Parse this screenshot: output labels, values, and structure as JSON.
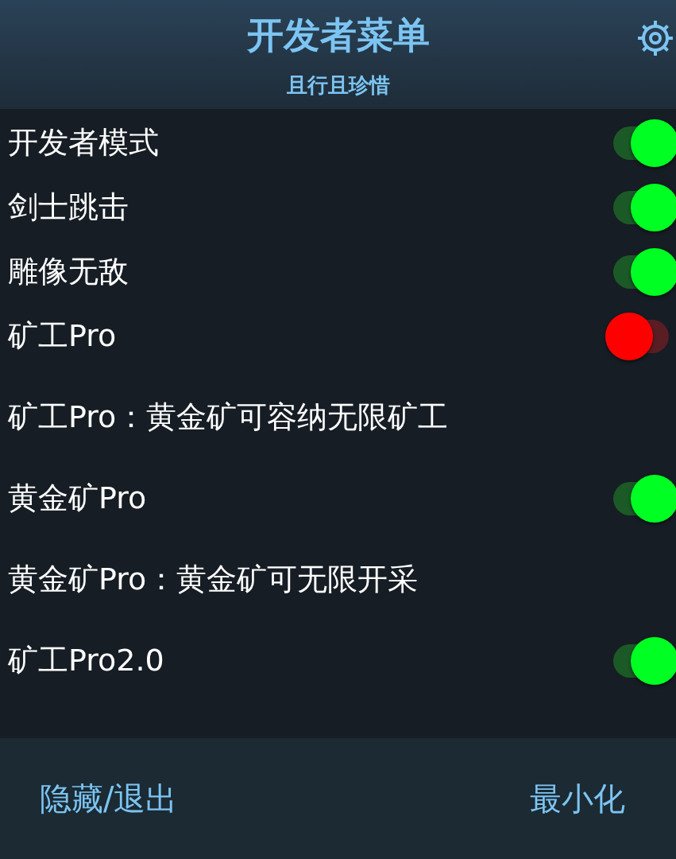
{
  "header": {
    "title": "开发者菜单",
    "subtitle": "且行且珍惜"
  },
  "items": [
    {
      "kind": "toggle",
      "label": "开发者模式",
      "on": true
    },
    {
      "kind": "toggle",
      "label": "剑士跳击",
      "on": true
    },
    {
      "kind": "toggle",
      "label": "雕像无敌",
      "on": true
    },
    {
      "kind": "toggle",
      "label": "矿工Pro",
      "on": false
    },
    {
      "kind": "description",
      "label": "矿工Pro：黄金矿可容纳无限矿工"
    },
    {
      "kind": "toggle",
      "label": "黄金矿Pro",
      "on": true
    },
    {
      "kind": "description",
      "label": "黄金矿Pro：黄金矿可无限开采"
    },
    {
      "kind": "toggle",
      "label": "矿工Pro2.0",
      "on": true
    }
  ],
  "footer": {
    "buttons": [
      "隐藏/退出",
      "最小化"
    ]
  }
}
